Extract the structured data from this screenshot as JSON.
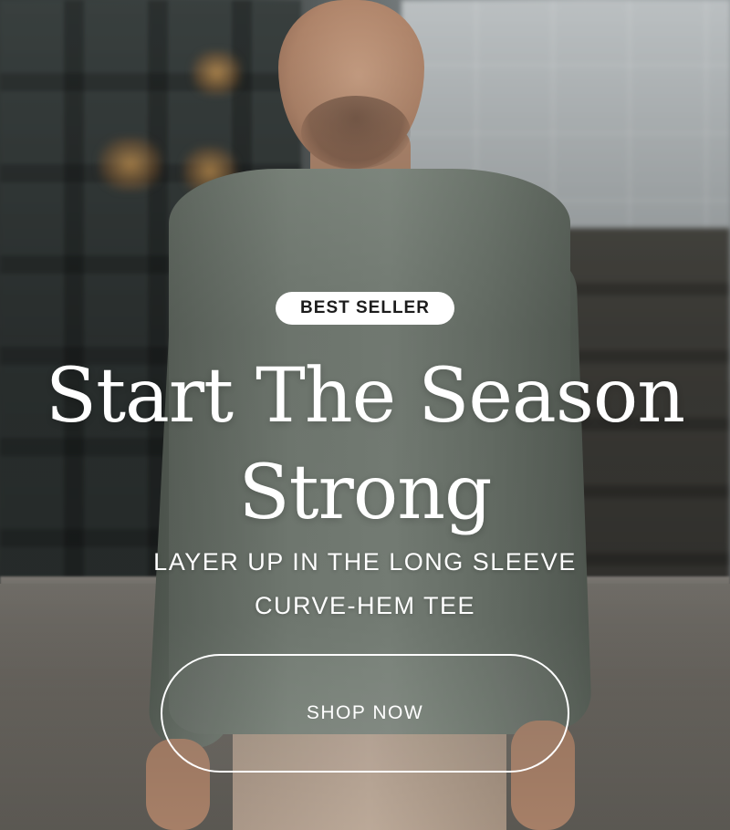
{
  "hero": {
    "badge": "BEST SELLER",
    "headline_line1": "Start The Season",
    "headline_line2": "Strong",
    "subhead_line1": "LAYER UP IN THE LONG SLEEVE",
    "subhead_line2": "CURVE-HEM TEE",
    "cta_label": "SHOP NOW"
  }
}
